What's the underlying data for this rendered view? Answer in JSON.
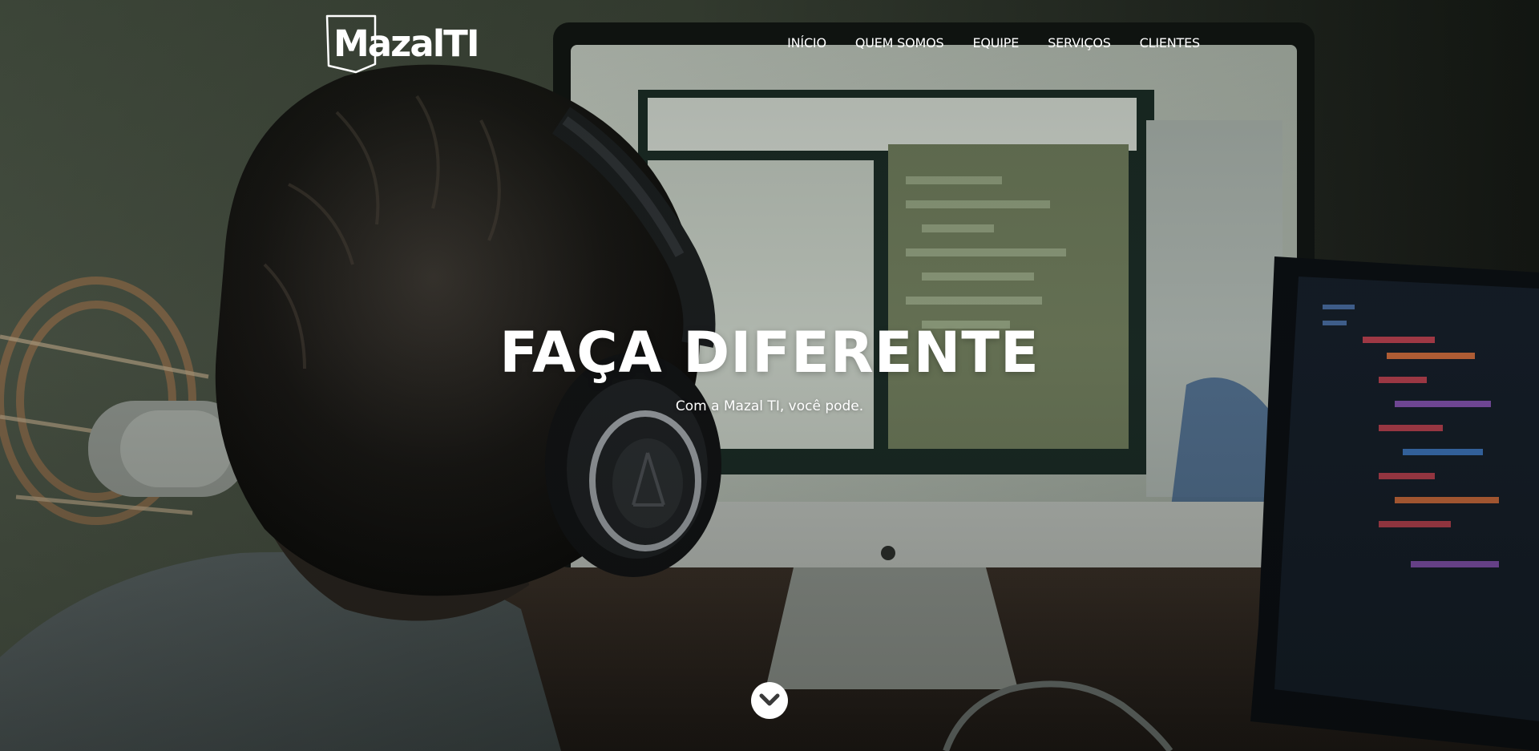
{
  "header": {
    "logo_text": "MazalTI",
    "nav": [
      {
        "label": "INÍCIO"
      },
      {
        "label": "QUEM SOMOS"
      },
      {
        "label": "EQUIPE"
      },
      {
        "label": "SERVIÇOS"
      },
      {
        "label": "CLIENTES"
      }
    ]
  },
  "hero": {
    "title": "FAÇA DIFERENTE",
    "subtitle": "Com a Mazal TI, você pode.",
    "scroll_icon": "chevron-down-icon"
  },
  "colors": {
    "text": "#ffffff",
    "scroll_button_bg": "#ffffff",
    "scroll_icon": "#3a3a3a"
  }
}
